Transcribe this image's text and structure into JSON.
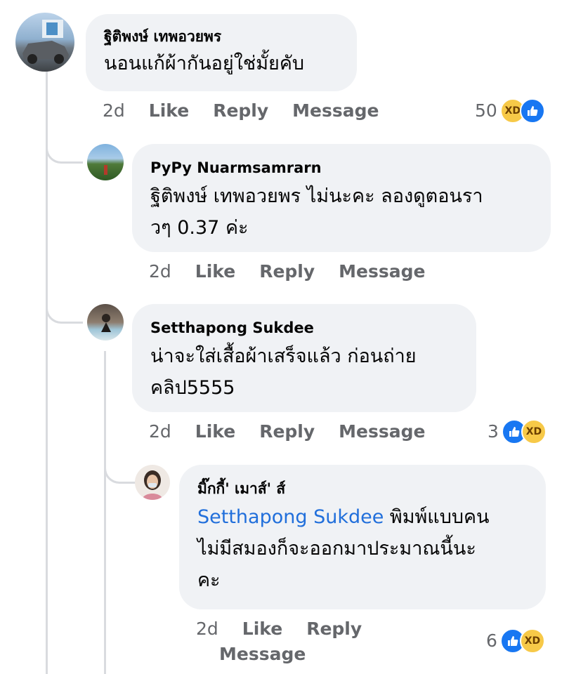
{
  "comments": [
    {
      "name": "ฐิติพงษ์ เทพอวยพร",
      "text": "นอนแก้ผ้ากันอยู่ใช่มั้ยคับ",
      "time": "2d",
      "like": "Like",
      "reply": "Reply",
      "message": "Message",
      "reactions": "50"
    },
    {
      "name": "PyPy Nuarmsamrarn",
      "text_line1": "ฐิติพงษ์ เทพอวยพร ไม่นะคะ ลองดูตอนรา",
      "text_line2": "วๆ 0.37 ค่ะ",
      "time": "2d",
      "like": "Like",
      "reply": "Reply",
      "message": "Message"
    },
    {
      "name": "Setthapong Sukdee",
      "text_line1": "น่าจะใส่เสื้อผ้าเสร็จแล้ว ก่อนถ่าย",
      "text_line2": "คลิป5555",
      "time": "2d",
      "like": "Like",
      "reply": "Reply",
      "message": "Message",
      "reactions": "3"
    },
    {
      "name": "มิ๊กกี้' เมาส์' ส์",
      "mention": "Setthapong Sukdee",
      "text_line1": " พิมพ์แบบคน",
      "text_line2": "ไม่มีสมองก็จะออกมาประมาณนี้นะ",
      "text_line3": "คะ",
      "time": "2d",
      "like": "Like",
      "reply": "Reply",
      "message": "Message",
      "reactions": "6"
    }
  ],
  "icons": {
    "haha": "haha-emoji",
    "like": "like-thumb"
  },
  "colors": {
    "bubble": "#f0f2f5",
    "mention": "#216fdb",
    "meta": "#65676b",
    "like_blue": "#1877f2",
    "haha_yellow": "#f7c948"
  }
}
